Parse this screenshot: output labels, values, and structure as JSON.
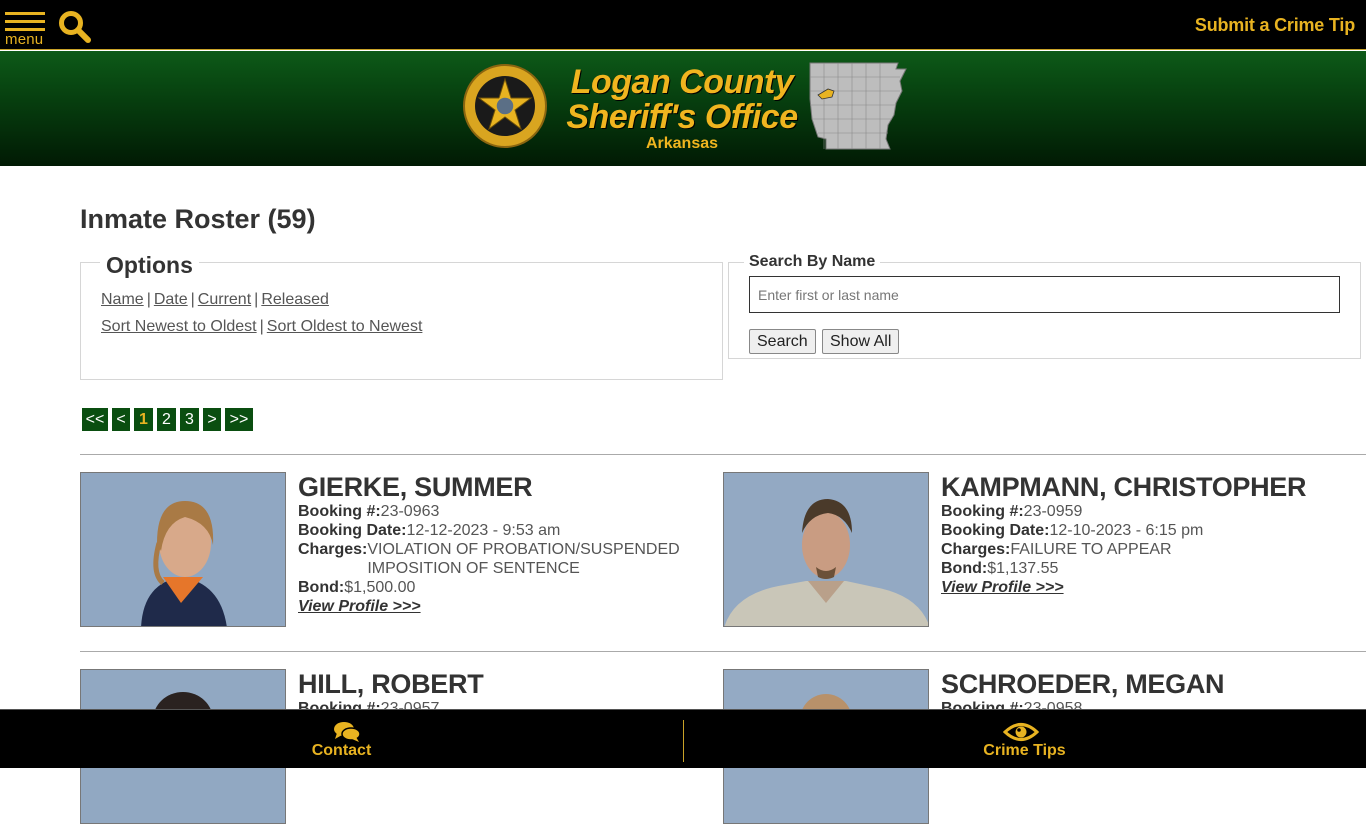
{
  "topbar": {
    "menu_label": "menu",
    "crime_tip_label": "Submit a Crime Tip",
    "accent": "#e8b321"
  },
  "banner": {
    "title_line1": "Logan County",
    "title_line2": "Sheriff's Office",
    "subtitle": "Arkansas",
    "badge_icon": "sheriff-star-badge",
    "map_icon": "arkansas-county-map"
  },
  "main": {
    "page_title": "Inmate Roster (59)",
    "options": {
      "legend": "Options",
      "sort_fields": [
        "Name",
        "Date",
        "Current",
        "Released"
      ],
      "sort_orders": [
        "Sort Newest to Oldest",
        "Sort Oldest to Newest"
      ],
      "separator": "|"
    },
    "search": {
      "legend": "Search By Name",
      "placeholder": "Enter first or last name",
      "value": "",
      "search_button": "Search",
      "show_all_button": "Show All"
    },
    "pagination": {
      "first": "<<",
      "prev": "<",
      "pages": [
        "1",
        "2",
        "3"
      ],
      "current_page": "1",
      "next": ">",
      "last": ">>"
    },
    "labels": {
      "booking_no": "Booking #:",
      "booking_date": "Booking Date:",
      "charges": "Charges:",
      "bond": "Bond:",
      "view_profile": "View Profile >>>"
    },
    "inmates": [
      {
        "name": "GIERKE, SUMMER",
        "booking_no": "23-0963",
        "booking_date": "12-12-2023 - 9:53 am",
        "charges_line1": "VIOLATION OF PROBATION/SUSPENDED",
        "charges_line2": "IMPOSITION OF SENTENCE",
        "bond": "$1,500.00"
      },
      {
        "name": "KAMPMANN, CHRISTOPHER",
        "booking_no": "23-0959",
        "booking_date": "12-10-2023 - 6:15 pm",
        "charges_line1": "FAILURE TO APPEAR",
        "charges_line2": "",
        "bond": "$1,137.55"
      },
      {
        "name": "HILL, ROBERT",
        "booking_no": "23-0957"
      },
      {
        "name": "SCHROEDER, MEGAN",
        "booking_no": "23-0958"
      }
    ]
  },
  "bottombar": {
    "contact_label": "Contact",
    "contact_icon": "chat-bubbles-icon",
    "crime_tips_label": "Crime Tips",
    "crime_tips_icon": "eye-icon"
  }
}
